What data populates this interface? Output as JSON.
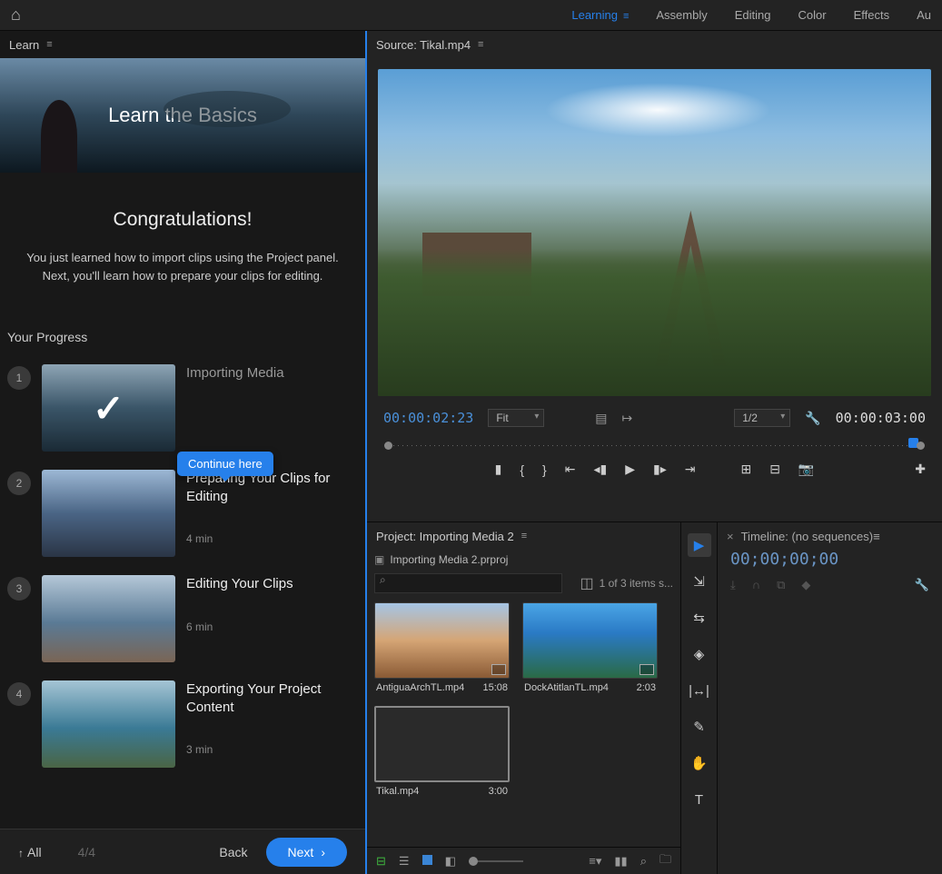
{
  "topbar": {
    "workspaces": [
      "Learning",
      "Assembly",
      "Editing",
      "Color",
      "Effects",
      "Au"
    ],
    "active": "Learning"
  },
  "learn": {
    "panel_title": "Learn",
    "hero_title": "Learn the Basics",
    "congrats_title": "Congratulations!",
    "congrats_body": "You just learned how to import clips using the Project panel. Next, you'll learn how to prepare your clips for editing.",
    "progress_title": "Your Progress",
    "tooltip": "Continue here",
    "lessons": [
      {
        "num": "1",
        "title": "Importing Media",
        "duration": "",
        "completed": true
      },
      {
        "num": "2",
        "title": "Preparing Your Clips for Editing",
        "duration": "4 min",
        "active": true
      },
      {
        "num": "3",
        "title": "Editing Your Clips",
        "duration": "6 min"
      },
      {
        "num": "4",
        "title": "Exporting Your Project Content",
        "duration": "3 min"
      }
    ],
    "footer": {
      "all": "All",
      "count": "4/4",
      "back": "Back",
      "next": "Next"
    }
  },
  "source": {
    "panel_title": "Source: Tikal.mp4",
    "playhead": "00:00:02:23",
    "fit": "Fit",
    "resolution": "1/2",
    "duration": "00:00:03:00"
  },
  "project": {
    "panel_title": "Project: Importing Media 2",
    "project_name": "Importing Media 2.prproj",
    "selection": "1 of 3 items s...",
    "bins": [
      {
        "name": "AntiguaArchTL.mp4",
        "duration": "15:08"
      },
      {
        "name": "DockAtitlanTL.mp4",
        "duration": "2:03"
      },
      {
        "name": "Tikal.mp4",
        "duration": "3:00",
        "selected": true
      }
    ]
  },
  "timeline": {
    "panel_title": "Timeline: (no sequences)",
    "time": "00;00;00;00"
  }
}
